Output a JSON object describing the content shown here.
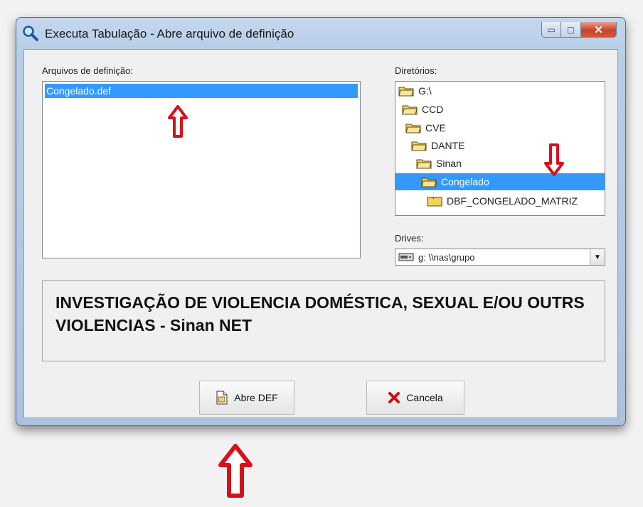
{
  "window": {
    "title": "Executa Tabulação - Abre arquivo de definição",
    "minimize_glyph": "▭",
    "maximize_glyph": "▢",
    "close_glyph": "✕"
  },
  "files": {
    "label": "Arquivos de definição:",
    "items": [
      "Congelado.def"
    ],
    "selected": "Congelado.def"
  },
  "directories": {
    "label": "Diretórios:",
    "items": [
      "G:\\",
      "CCD",
      "CVE",
      "DANTE",
      "Sinan",
      "Congelado",
      "DBF_CONGELADO_MATRIZ"
    ],
    "selected": "Congelado"
  },
  "drives": {
    "label": "Drives:",
    "value": "g: \\\\nas\\grupo",
    "dropdown_glyph": "▼"
  },
  "description": "INVESTIGAÇÃO DE VIOLENCIA DOMÉSTICA, SEXUAL E/OU OUTRS VIOLENCIAS - Sinan NET",
  "buttons": {
    "open_label": "Abre DEF",
    "cancel_label": "Cancela"
  },
  "colors": {
    "selection": "#3399ff",
    "annotation_arrow": "#d8101a",
    "folder": "#f4d35a"
  },
  "icons": [
    "magnifier-icon",
    "folder-icon",
    "drive-icon",
    "document-icon",
    "red-x-icon",
    "annotation-arrow-icon"
  ]
}
